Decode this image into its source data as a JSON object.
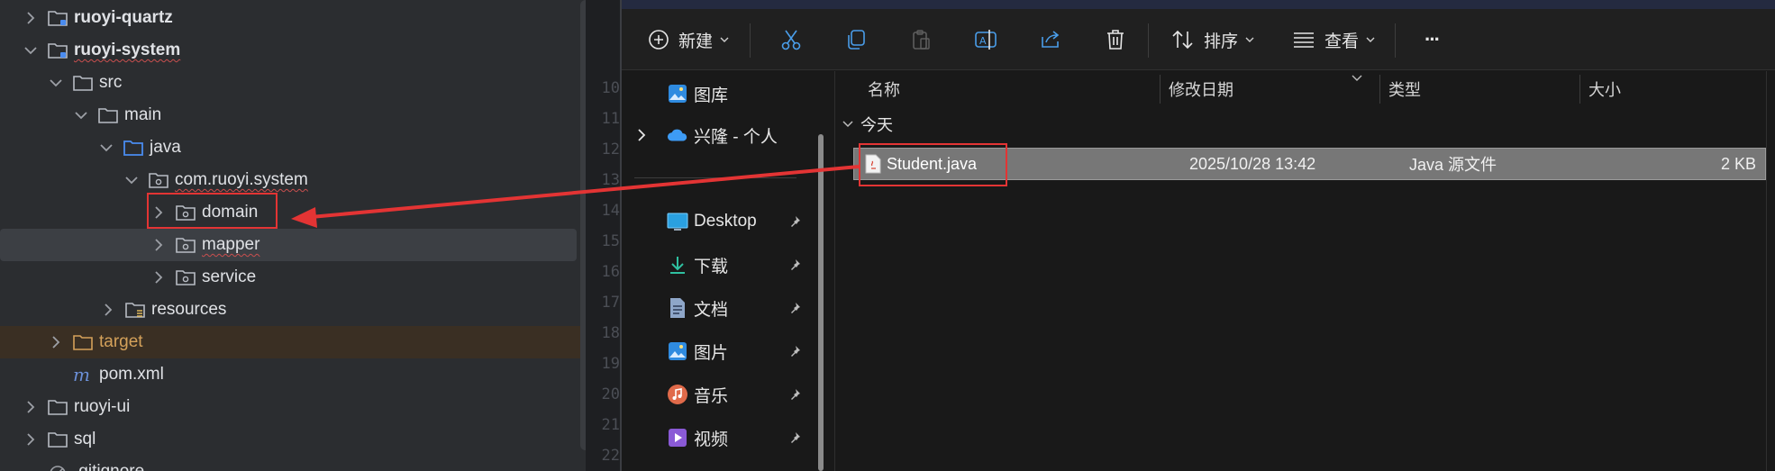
{
  "ide": {
    "tree": [
      {
        "label": "ruoyi-quartz",
        "bold": true,
        "squiggle": false
      },
      {
        "label": "ruoyi-system",
        "bold": true,
        "squiggle": true
      },
      {
        "label": "src"
      },
      {
        "label": "main"
      },
      {
        "label": "java"
      },
      {
        "label": "com.ruoyi.system",
        "squiggle": true
      },
      {
        "label": "domain"
      },
      {
        "label": "mapper",
        "squiggle": true
      },
      {
        "label": "service"
      },
      {
        "label": "resources"
      },
      {
        "label": "target"
      },
      {
        "label": "pom.xml"
      },
      {
        "label": "ruoyi-ui"
      },
      {
        "label": "sql"
      },
      {
        "label": ".gitignore"
      }
    ],
    "editor_line_numbers": [
      "10",
      "11",
      "12",
      "13",
      "14",
      "15",
      "16",
      "17",
      "18",
      "19",
      "20",
      "21",
      "22"
    ]
  },
  "explorer": {
    "toolbar": {
      "new_label": "新建",
      "sort_label": "排序",
      "view_label": "查看",
      "more_label": "···"
    },
    "nav": [
      {
        "label": "图库"
      },
      {
        "label": "兴隆 - 个人"
      },
      {
        "label": "Desktop"
      },
      {
        "label": "下载"
      },
      {
        "label": "文档"
      },
      {
        "label": "图片"
      },
      {
        "label": "音乐"
      },
      {
        "label": "视频"
      }
    ],
    "columns": {
      "name": "名称",
      "modified": "修改日期",
      "type": "类型",
      "size": "大小"
    },
    "group_label": "今天",
    "files": [
      {
        "name": "Student.java",
        "modified": "2025/10/28 13:42",
        "type": "Java 源文件",
        "size": "2 KB"
      }
    ]
  },
  "colors": {
    "annotation_red": "#e33434",
    "excluded_folder": "#d4a15a",
    "java_folder_blue": "#4a8cf0"
  }
}
